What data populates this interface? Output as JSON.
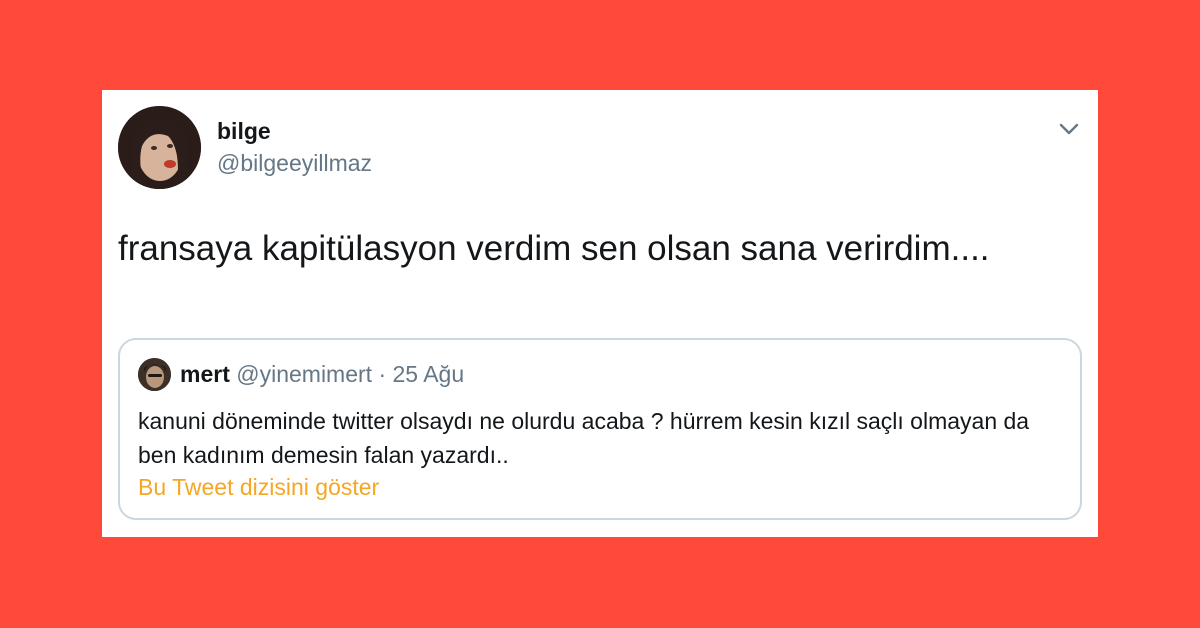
{
  "tweet": {
    "author_name": "bilge",
    "author_handle": "@bilgeeyillmaz",
    "text": "fransaya kapitülasyon verdim sen olsan sana verirdim...."
  },
  "quoted_tweet": {
    "author_name": "mert",
    "author_handle": "@yinemimert",
    "separator": "·",
    "date": "25 Ağu",
    "text": "kanuni döneminde twitter olsaydı ne olurdu acaba ? hürrem kesin kızıl saçlı olmayan da ben kadınım demesin falan yazardı..",
    "thread_link": "Bu Tweet dizisini göster"
  },
  "icons": {
    "menu": "chevron-down-icon"
  },
  "colors": {
    "background": "#ff4a3b",
    "card": "#ffffff",
    "text": "#14171a",
    "secondary_text": "#657786",
    "link": "#f5a623",
    "border": "#ccd6dd"
  }
}
